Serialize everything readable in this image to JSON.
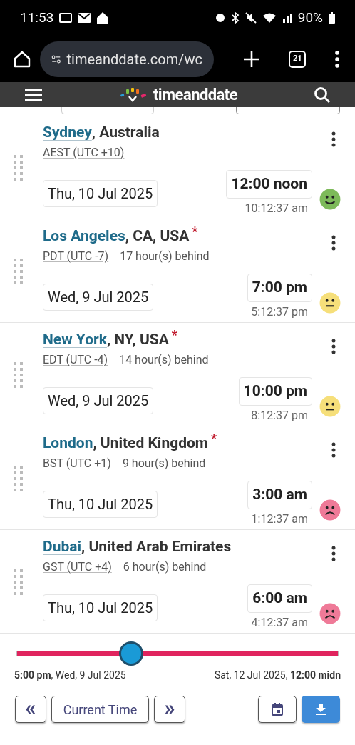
{
  "status_bar": {
    "time": "11:53",
    "battery": "90%"
  },
  "browser": {
    "url": "timeanddate.com/wc",
    "tab_count": "21"
  },
  "site_header": {
    "logo_text": "timeanddate"
  },
  "cities": [
    {
      "city": "Sydney",
      "region": ", Australia",
      "zone": "AEST (UTC +10)",
      "date": "Thu, 10 Jul 2025",
      "time": "12:00 noon",
      "local_time": "10:12:37 am",
      "face": {
        "kind": "happy"
      }
    },
    {
      "city": "Los Angeles",
      "region": ", CA, USA",
      "note_mark": "*",
      "zone": "PDT (UTC -7)",
      "offset": "17 hour(s) behind",
      "date": "Wed, 9 Jul 2025",
      "time": "7:00 pm",
      "local_time": "5:12:37 pm",
      "face": {
        "kind": "neutral"
      }
    },
    {
      "city": "New York",
      "region": ", NY, USA",
      "note_mark": "*",
      "zone": "EDT (UTC -4)",
      "offset": "14 hour(s) behind",
      "date": "Wed, 9 Jul 2025",
      "time": "10:00 pm",
      "local_time": "8:12:37 pm",
      "face": {
        "kind": "neutral"
      }
    },
    {
      "city": "London",
      "region": ", United Kingdom",
      "note_mark": "*",
      "zone": "BST (UTC +1)",
      "offset": "9 hour(s) behind",
      "date": "Thu, 10 Jul 2025",
      "time": "3:00 am",
      "local_time": "1:12:37 am",
      "face": {
        "kind": "sad"
      }
    },
    {
      "city": "Dubai",
      "region": ", United Arab Emirates",
      "zone": "GST (UTC +4)",
      "offset": "6 hour(s) behind",
      "date": "Thu, 10 Jul 2025",
      "time": "6:00 am",
      "local_time": "4:12:37 am",
      "face": {
        "kind": "sad"
      }
    }
  ],
  "timeline": {
    "level": 0.357,
    "start_label": "**5:00 pm**, Wed, 9 Jul 2025",
    "end_label": "Sat, 12 Jul 2025, **12:00 midn**"
  },
  "controls": {
    "prev": "«",
    "current": "Current Time",
    "next": "»"
  }
}
